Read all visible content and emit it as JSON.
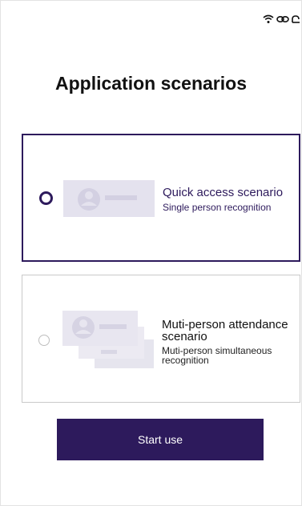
{
  "page": {
    "title": "Application scenarios"
  },
  "scenarios": [
    {
      "title": "Quick access scenario",
      "subtitle": "Single person recognition"
    },
    {
      "title": "Muti-person attendance scenario",
      "subtitle": "Muti-person simultaneous recognition"
    }
  ],
  "actions": {
    "start_label": "Start use"
  },
  "status_bar": {
    "icons": [
      "wifi-icon",
      "link-icon",
      "cloud-icon"
    ]
  },
  "colors": {
    "accent": "#2d1a5c",
    "placeholder": "#dcdae8"
  }
}
